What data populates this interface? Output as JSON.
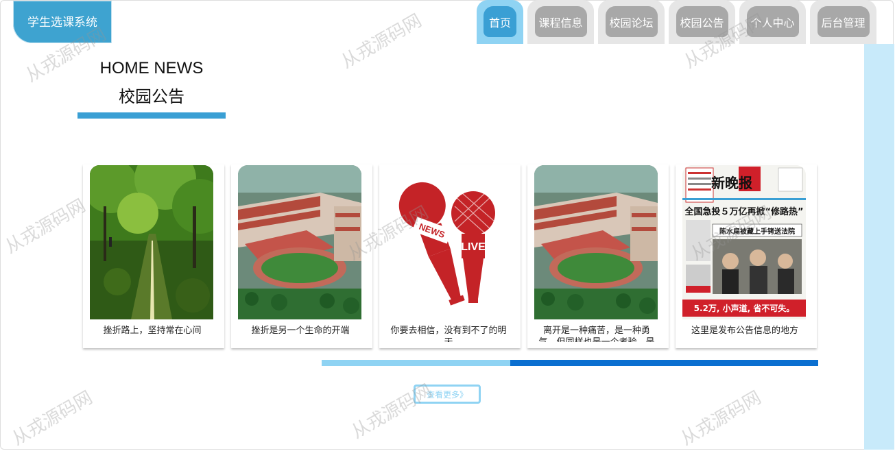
{
  "header": {
    "brand": "学生选课系统",
    "nav": [
      {
        "label": "首页",
        "active": true
      },
      {
        "label": "课程信息",
        "active": false
      },
      {
        "label": "校园论坛",
        "active": false
      },
      {
        "label": "校园公告",
        "active": false
      },
      {
        "label": "个人中心",
        "active": false
      },
      {
        "label": "后台管理",
        "active": false
      }
    ]
  },
  "section": {
    "title_en": "HOME NEWS",
    "title_cn": "校园公告"
  },
  "cards": [
    {
      "caption": "挫折路上，坚持常在心间",
      "image": "tree-lined-road-photo"
    },
    {
      "caption": "挫折是另一个生命的开端",
      "image": "campus-aerial-photo"
    },
    {
      "caption": "你要去相信，没有到不了的明天",
      "image": "news-live-microphones-icon"
    },
    {
      "caption": "离开是一种痛苦，是一种勇气，但同样也是一个考验，是",
      "image": "campus-aerial-photo"
    },
    {
      "caption": "这里是发布公告信息的地方",
      "image": "newspaper-front-page",
      "newspaper_name": "新晚报",
      "headline": "全国急投５万亿再掀“修路热”",
      "subhead": "陈水扁被藏上手铐送法院",
      "ad": "5.2万, 小声道, 省不可失。"
    }
  ],
  "carousel_progress": 0.38,
  "more_button": "查看更多》",
  "watermark": "从戎源码网",
  "colors": {
    "accent": "#3a9fd4",
    "light": "#8fd3f3",
    "dark": "#0b6fd0",
    "tab_gray": "#a8a8a8"
  }
}
